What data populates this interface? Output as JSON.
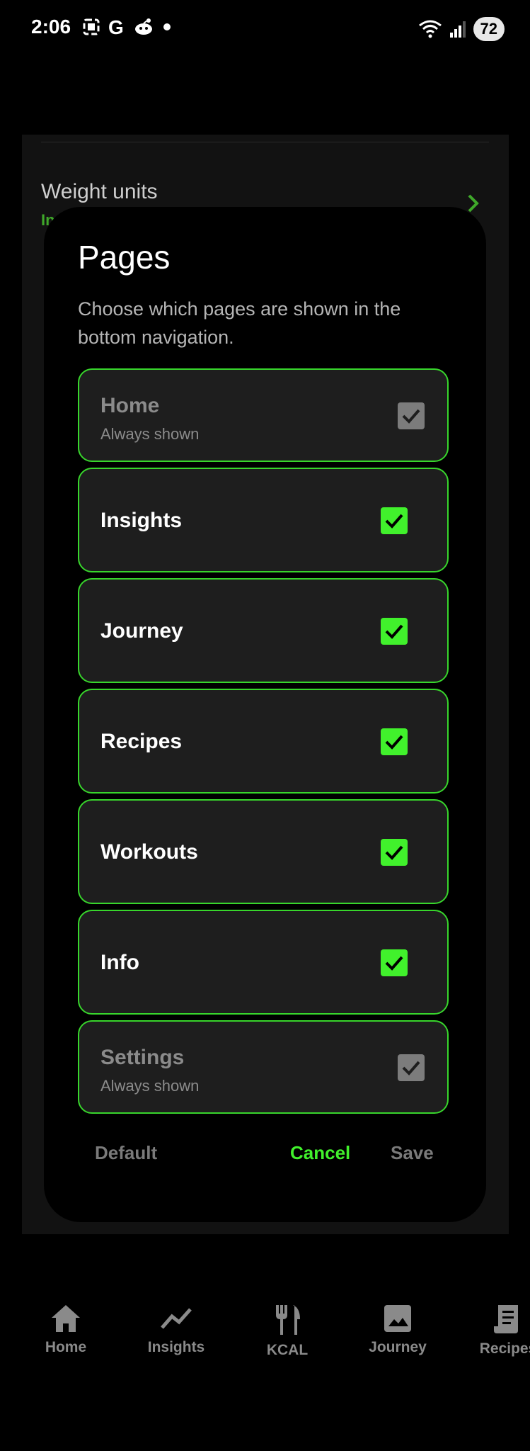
{
  "status_bar": {
    "time": "2:06",
    "battery": "72",
    "icons": [
      "screenshot-icon",
      "google-icon",
      "reddit-icon",
      "notification-dot-icon",
      "wifi-icon",
      "signal-icon"
    ]
  },
  "background": {
    "row_title": "Weight units",
    "row_sub": "In"
  },
  "dialog": {
    "title": "Pages",
    "description": "Choose which pages are shown in the bottom navigation.",
    "options": [
      {
        "label": "Home",
        "hint": "Always shown",
        "checked": true,
        "disabled": true
      },
      {
        "label": "Insights",
        "checked": true,
        "disabled": false
      },
      {
        "label": "Journey",
        "checked": true,
        "disabled": false
      },
      {
        "label": "Recipes",
        "checked": true,
        "disabled": false
      },
      {
        "label": "Workouts",
        "checked": true,
        "disabled": false
      },
      {
        "label": "Info",
        "checked": true,
        "disabled": false
      },
      {
        "label": "Settings",
        "hint": "Always shown",
        "checked": true,
        "disabled": true
      }
    ],
    "actions": {
      "default": "Default",
      "cancel": "Cancel",
      "save": "Save"
    }
  },
  "bottom_nav": {
    "items": [
      {
        "label": "Home",
        "icon": "home-icon"
      },
      {
        "label": "Insights",
        "icon": "trend-icon"
      },
      {
        "label": "KCAL",
        "icon": "fork-knife-icon"
      },
      {
        "label": "Journey",
        "icon": "image-icon"
      },
      {
        "label": "Recipes",
        "icon": "receipt-icon"
      }
    ]
  },
  "colors": {
    "accent": "#41f12c",
    "accent_border": "#38d62c",
    "disabled_check": "#7c7c7c",
    "card_bg": "#1e1e1e"
  }
}
